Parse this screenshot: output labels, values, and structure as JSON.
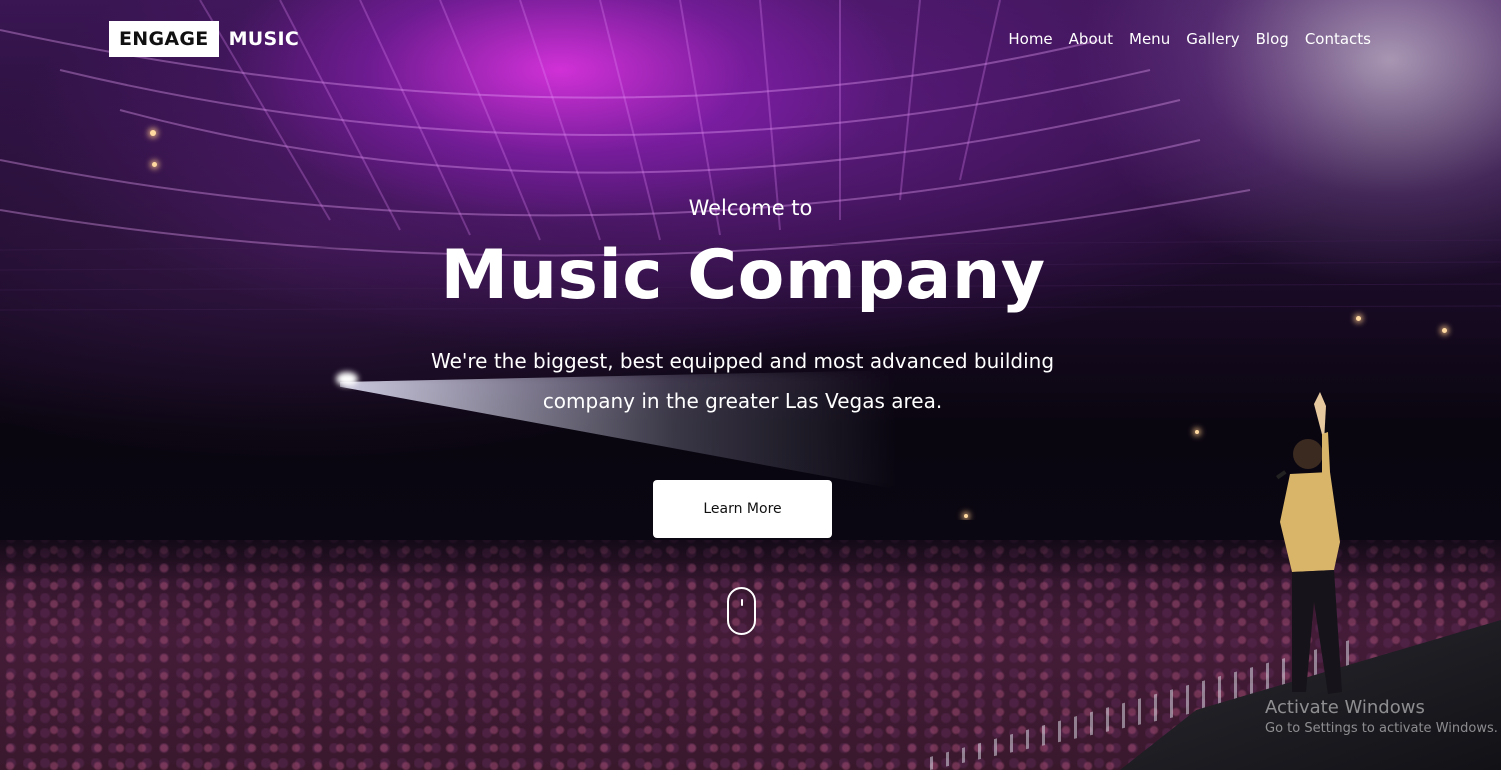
{
  "brand": {
    "box_text": "ENGAGE",
    "text": "MUSIC"
  },
  "nav": {
    "items": [
      {
        "label": "Home"
      },
      {
        "label": "About"
      },
      {
        "label": "Menu"
      },
      {
        "label": "Gallery"
      },
      {
        "label": "Blog"
      },
      {
        "label": "Contacts"
      }
    ]
  },
  "hero": {
    "welcome": "Welcome to",
    "title": "Music Company",
    "subtitle": "We're the biggest, best equipped and most advanced building company in the greater Las Vegas area.",
    "cta_label": "Learn More",
    "scroll_icon": "mouse-scroll-icon",
    "background": "concert-arena-photo"
  },
  "os_watermark": {
    "line1": "Activate Windows",
    "line2": "Go to Settings to activate Windows."
  }
}
